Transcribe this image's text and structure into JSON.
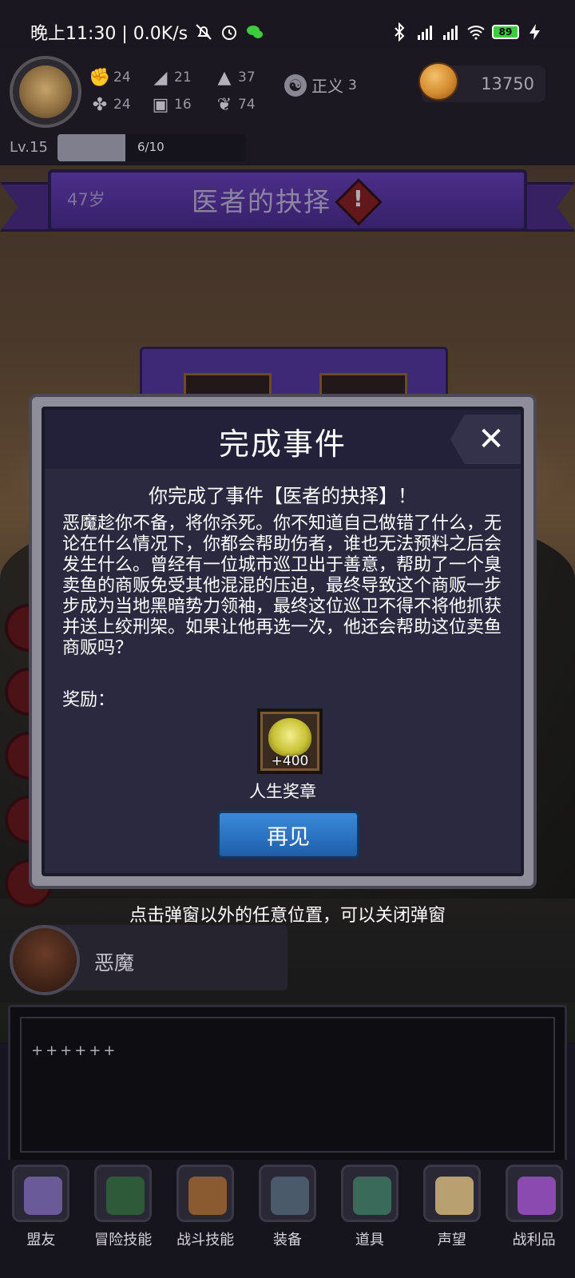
{
  "status_bar": {
    "time": "晚上11:30 | 0.0K/s",
    "battery": "89"
  },
  "hud": {
    "stats": [
      {
        "icon": "fist-icon",
        "value": "24"
      },
      {
        "icon": "boot-icon",
        "value": "21"
      },
      {
        "icon": "wizard-hat-icon",
        "value": "37"
      },
      {
        "icon": "clover-icon",
        "value": "24"
      },
      {
        "icon": "armor-icon",
        "value": "16"
      },
      {
        "icon": "leaf-icon",
        "value": "74"
      }
    ],
    "alignment": {
      "icon": "yin-yang-icon",
      "label": "正义",
      "value": "3"
    },
    "gold": "13750",
    "level": "Lv.15",
    "xp_text": "6/10",
    "xp_progress": 0.6
  },
  "banner": {
    "age": "47岁",
    "title": "医者的抉择"
  },
  "modal": {
    "title": "完成事件",
    "subtitle": "你完成了事件【医者的抉择】！",
    "body": "恶魔趁你不备，将你杀死。你不知道自己做错了什么，无论在什么情况下，你都会帮助伤者，谁也无法预料之后会发生什么。曾经有一位城市巡卫出于善意，帮助了一个臭卖鱼的商贩免受其他混混的压迫，最终导致这个商贩一步步成为当地黑暗势力领袖，最终这位巡卫不得不将他抓获并送上绞刑架。如果让他再选一次，他还会帮助这位卖鱼商贩吗？",
    "reward_label": "奖励：",
    "reward": {
      "amount": "+400",
      "name": "人生奖章"
    },
    "confirm_label": "再见"
  },
  "hint": "点击弹窗以外的任意位置，可以关闭弹窗",
  "speaker": {
    "name": "恶魔"
  },
  "log": {
    "text": "++++++"
  },
  "nav": [
    {
      "label": "盟友",
      "icon": "handshake-icon",
      "color": "#6a5a9a"
    },
    {
      "label": "冒险技能",
      "icon": "spellbook-icon",
      "color": "#2f5a3a"
    },
    {
      "label": "战斗技能",
      "icon": "backpack-icon",
      "color": "#8a5a30"
    },
    {
      "label": "装备",
      "icon": "crossed-swords-icon",
      "color": "#4a5a6a"
    },
    {
      "label": "道具",
      "icon": "pouch-icon",
      "color": "#3a6a5a"
    },
    {
      "label": "声望",
      "icon": "scroll-icon",
      "color": "#b8a070"
    },
    {
      "label": "战利品",
      "icon": "treasure-chest-icon",
      "color": "#8a4ab0"
    }
  ]
}
